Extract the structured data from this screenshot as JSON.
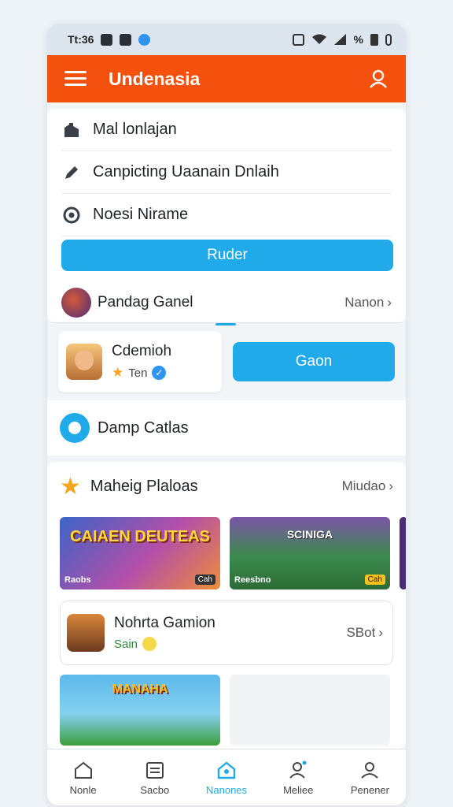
{
  "status_bar": {
    "time": "Tt:36",
    "battery_text": "%"
  },
  "app_bar": {
    "title": "Undenasia"
  },
  "menu": {
    "items": [
      {
        "label": "Mal lonlajan",
        "icon": "building-icon"
      },
      {
        "label": "Canpicting Uaanain Dnlaih",
        "icon": "pencil-icon"
      },
      {
        "label": "Noesi Nirame",
        "icon": "globe-icon"
      }
    ],
    "primary_button": "Ruder",
    "game": {
      "name": "Pandag Ganel",
      "more": "Nanon"
    }
  },
  "profile": {
    "name": "Cdemioh",
    "rank": "Ten"
  },
  "go_button": "Gaon",
  "daily_row": {
    "label": "Damp Catlas"
  },
  "featured": {
    "title": "Maheig Plaloas",
    "more": "Miudao",
    "tiles": [
      {
        "title": "CAIAEN DEUTEAS",
        "caption": "Raobs",
        "tag": "Cah"
      },
      {
        "title": "SCINIGA",
        "caption": "Reesbno",
        "tag": "Cah"
      }
    ],
    "list_item": {
      "name": "Nohrta Gamion",
      "sub": "Sain",
      "more": "SBot"
    },
    "bottom_tile": {
      "title": "MANAHA"
    }
  },
  "bottom_nav": [
    {
      "label": "Nonle",
      "icon": "home-icon"
    },
    {
      "label": "Sacbo",
      "icon": "calendar-icon"
    },
    {
      "label": "Nanones",
      "icon": "home-active-icon"
    },
    {
      "label": "Meliee",
      "icon": "person-notify-icon"
    },
    {
      "label": "Penener",
      "icon": "profile-icon"
    }
  ],
  "colors": {
    "accent": "#f4510e",
    "primary": "#21aaea",
    "star": "#f6a51c"
  }
}
